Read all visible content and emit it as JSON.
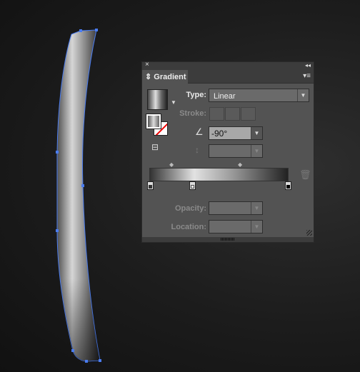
{
  "panel": {
    "title": "Gradient",
    "type_label": "Type:",
    "type_value": "Linear",
    "stroke_label": "Stroke:",
    "angle_value": "-90°",
    "opacity_label": "Opacity:",
    "opacity_value": "",
    "location_label": "Location:",
    "location_value": "",
    "close_icon": "×",
    "collapse_icon": "◂◂",
    "menu_icon": "▾≡"
  },
  "gradient": {
    "stops": [
      {
        "color": "#2a2a2a",
        "location": 0
      },
      {
        "color": "#e0e0e0",
        "location": 30
      },
      {
        "color": "#000000",
        "location": 100
      }
    ],
    "midpoints": [
      15,
      65
    ]
  },
  "colors": {
    "selection": "#4a7cf0",
    "panel": "#535353"
  }
}
